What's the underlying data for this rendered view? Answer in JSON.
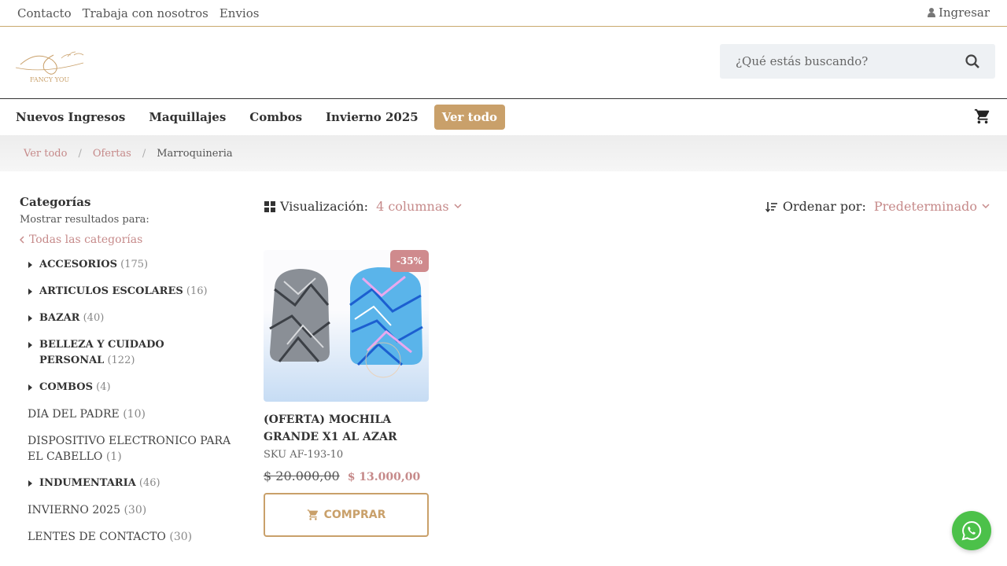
{
  "topbar": {
    "links": [
      "Contacto",
      "Trabaja con nosotros",
      "Envios"
    ],
    "login": "Ingresar"
  },
  "search": {
    "placeholder": "¿Qué estás buscando?"
  },
  "nav": {
    "items": [
      "Nuevos Ingresos",
      "Maquillajes",
      "Combos",
      "Invierno 2025"
    ],
    "cta": "Ver todo"
  },
  "breadcrumb": {
    "items": [
      "Ver todo",
      "Ofertas"
    ],
    "current": "Marroquineria"
  },
  "sidebar": {
    "title": "Categorías",
    "subtitle": "Mostrar resultados para:",
    "all": "Todas las categorías",
    "categories": [
      {
        "name": "ACCESORIOS",
        "count": "(175)"
      },
      {
        "name": "ARTICULOS ESCOLARES",
        "count": "(16)"
      },
      {
        "name": "BAZAR",
        "count": "(40)"
      },
      {
        "name": "BELLEZA Y CUIDADO PERSONAL",
        "count": "(122)"
      },
      {
        "name": "COMBOS",
        "count": "(4)"
      },
      {
        "name": "DIA DEL PADRE",
        "count": "(10)"
      },
      {
        "name": "DISPOSITIVO ELECTRONICO PARA EL CABELLO",
        "count": "(1)"
      },
      {
        "name": "INDUMENTARIA",
        "count": "(46)"
      },
      {
        "name": "INVIERNO 2025",
        "count": "(30)"
      },
      {
        "name": "LENTES DE CONTACTO",
        "count": "(30)"
      }
    ]
  },
  "toolbar": {
    "viz_label": "Visualización:",
    "viz_value": "4 columnas",
    "sort_label": "Ordenar por:",
    "sort_value": "Predeterminado"
  },
  "product": {
    "badge": "-35%",
    "title": "(OFERTA) MOCHILA GRANDE X1 AL AZAR",
    "sku": "SKU AF-193-10",
    "old_price": "$  20.000,00",
    "new_price": "$  13.000,00",
    "buy_label": "COMPRAR"
  },
  "colors": {
    "accent": "#c9a06a",
    "link": "#c68a8a",
    "whatsapp": "#4cc14a"
  },
  "icons": [
    "user-icon",
    "search-icon",
    "cart-icon",
    "grid-icon",
    "sort-icon",
    "chevron-down-icon",
    "chevron-left-icon",
    "whatsapp-icon"
  ]
}
